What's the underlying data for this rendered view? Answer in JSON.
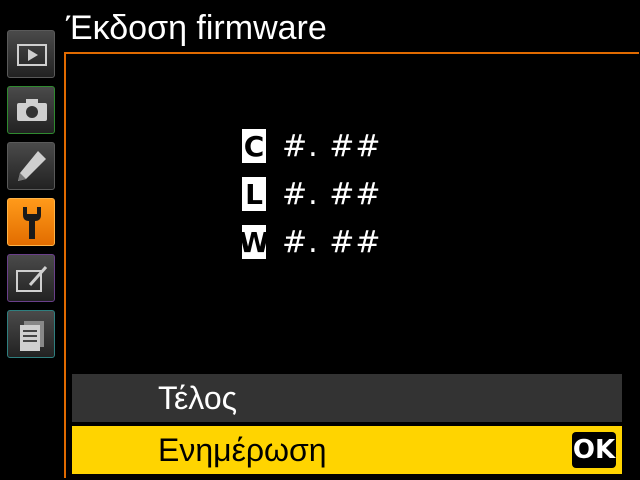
{
  "header": {
    "title": "Έκδοση firmware"
  },
  "sidebar": {
    "tabs": [
      {
        "name": "playback-menu",
        "icon": "play-icon",
        "active": false
      },
      {
        "name": "shooting-menu",
        "icon": "camera-icon",
        "active": false
      },
      {
        "name": "custom-settings-menu",
        "icon": "pencil-icon",
        "active": false
      },
      {
        "name": "setup-menu",
        "icon": "wrench-icon",
        "active": true
      },
      {
        "name": "retouch-menu",
        "icon": "retouch-brush-icon",
        "active": false
      },
      {
        "name": "recent-settings-menu",
        "icon": "pages-icon",
        "active": false
      }
    ]
  },
  "firmware": [
    {
      "letter": "C",
      "version": "#. ##"
    },
    {
      "letter": "L",
      "version": "#. ##"
    },
    {
      "letter": "W",
      "version": "#. ##"
    }
  ],
  "options": {
    "done_label": "Τέλος",
    "update_label": "Ενημέρωση",
    "ok_label": "OK"
  },
  "colors": {
    "accent_orange": "#e06a00",
    "highlight_yellow": "#ffd400",
    "row_gray": "#333333"
  }
}
